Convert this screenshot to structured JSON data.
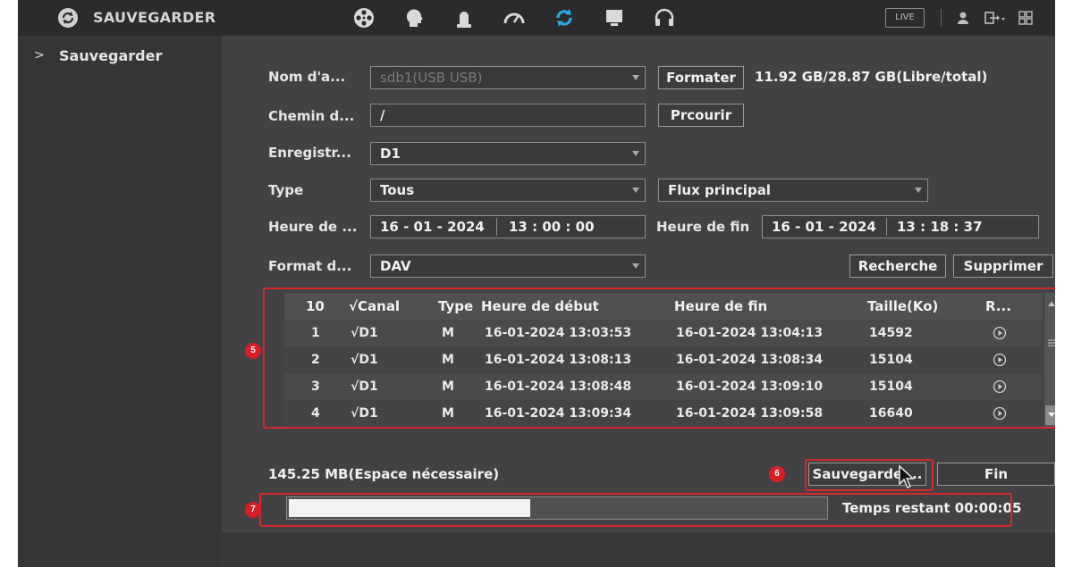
{
  "app": {
    "title": "SAUVEGARDER",
    "live_label": "LIVE"
  },
  "icons": {
    "app": "backup-refresh-icon",
    "nav": [
      "film-reel-icon",
      "head-icon",
      "bell-icon",
      "gauge-icon",
      "backup-refresh-icon",
      "monitor-icon",
      "headset-icon"
    ],
    "top_right": [
      "user-icon",
      "logout-icon",
      "grid-icon"
    ]
  },
  "sidebar": {
    "items": [
      {
        "label": "Sauvegarder",
        "active": true
      }
    ]
  },
  "form": {
    "device_label": "Nom d'a...",
    "device_value": "sdb1(USB USB)",
    "format_button": "Formater",
    "storage_info": "11.92 GB/28.87 GB(Libre/total)",
    "path_label": "Chemin d...",
    "path_value": "/",
    "browse_button": "Prcourir",
    "recorder_label": "Enregistr...",
    "recorder_value": "D1",
    "type_label": "Type",
    "type_value": "Tous",
    "stream_value": "Flux principal",
    "start_label": "Heure de ...",
    "start_date": "16 - 01 - 2024",
    "start_time": "13 : 00 : 00",
    "end_label": "Heure de fin",
    "end_date": "16 - 01 - 2024",
    "end_time": "13 : 18 : 37",
    "format_label": "Format d...",
    "format_value": "DAV",
    "search_button": "Recherche",
    "delete_button": "Supprimer"
  },
  "table": {
    "headers": {
      "count": "10",
      "canal": "√Canal",
      "type": "Type",
      "start": "Heure de début",
      "end": "Heure de fin",
      "size": "Taille(Ko)",
      "replay": "R..."
    },
    "rows": [
      {
        "n": "1",
        "canal": "√D1",
        "type": "M",
        "start": "16-01-2024 13:03:53",
        "end": "16-01-2024 13:04:13",
        "size": "14592"
      },
      {
        "n": "2",
        "canal": "√D1",
        "type": "M",
        "start": "16-01-2024 13:08:13",
        "end": "16-01-2024 13:08:34",
        "size": "15104"
      },
      {
        "n": "3",
        "canal": "√D1",
        "type": "M",
        "start": "16-01-2024 13:08:48",
        "end": "16-01-2024 13:09:10",
        "size": "15104"
      },
      {
        "n": "4",
        "canal": "√D1",
        "type": "M",
        "start": "16-01-2024 13:09:34",
        "end": "16-01-2024 13:09:58",
        "size": "16640"
      }
    ]
  },
  "footer": {
    "space_needed": "145.25 MB(Espace nécessaire)",
    "backup_button": "Sauvegarde ...",
    "end_button": "Fin",
    "time_remaining": "Temps restant 00:00:05",
    "progress": 0.45
  },
  "annotations": {
    "table": "5",
    "backup": "6",
    "progress": "7"
  },
  "colors": {
    "annotation_red": "#d62a2a",
    "badge_red": "#d81f26",
    "active_icon": "#29a9e6",
    "panel": "#424244"
  }
}
